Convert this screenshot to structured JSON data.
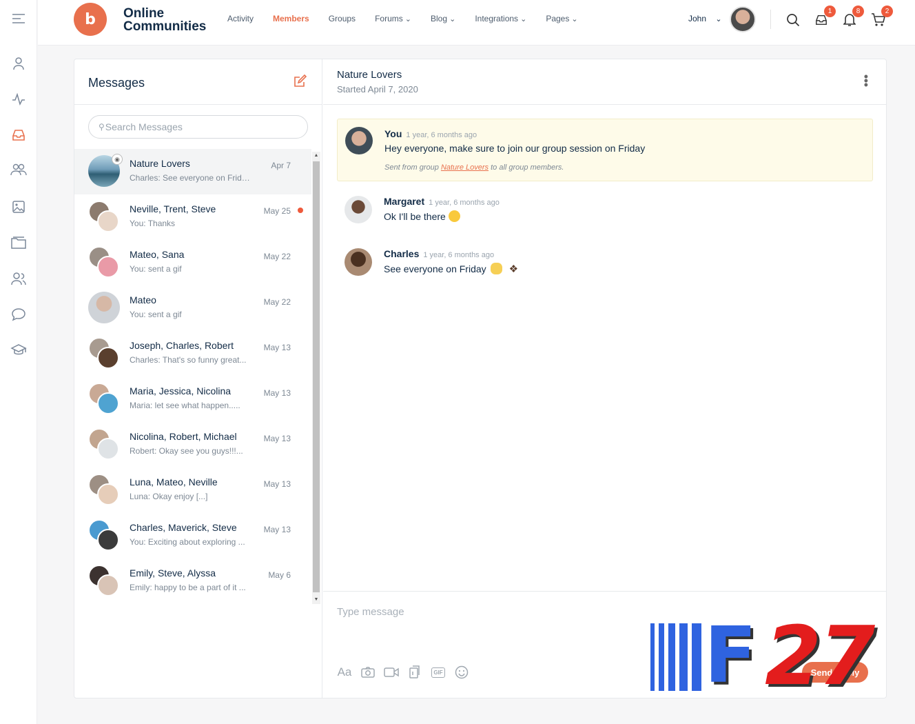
{
  "brand": {
    "name_line1": "Online",
    "name_line2": "Communities",
    "logo_text": "b"
  },
  "nav": [
    {
      "label": "Activity",
      "active": false,
      "dropdown": false
    },
    {
      "label": "Members",
      "active": true,
      "dropdown": false
    },
    {
      "label": "Groups",
      "active": false,
      "dropdown": false
    },
    {
      "label": "Forums",
      "active": false,
      "dropdown": true
    },
    {
      "label": "Blog",
      "active": false,
      "dropdown": true
    },
    {
      "label": "Integrations",
      "active": false,
      "dropdown": true
    },
    {
      "label": "Pages",
      "active": false,
      "dropdown": true
    }
  ],
  "header": {
    "user_name": "John",
    "badges": {
      "messages": "1",
      "notifications": "8",
      "cart": "2"
    }
  },
  "sidebar_icons": [
    "menu-icon",
    "profile-icon",
    "activity-icon",
    "inbox-icon",
    "groups-icon",
    "photos-icon",
    "folder-icon",
    "friends-icon",
    "forums-icon",
    "courses-icon"
  ],
  "messages": {
    "title": "Messages",
    "search_placeholder": "Search Messages",
    "threads": [
      {
        "names": "Nature Lovers",
        "preview": "Charles: See everyone on Friday",
        "date": "Apr 7",
        "active": true,
        "unread": false
      },
      {
        "names": "Neville, Trent, Steve",
        "preview": "You: Thanks",
        "date": "May 25",
        "active": false,
        "unread": true
      },
      {
        "names": "Mateo, Sana",
        "preview": "You: sent a gif",
        "date": "May 22",
        "active": false,
        "unread": false
      },
      {
        "names": "Mateo",
        "preview": "You: sent a gif",
        "date": "May 22",
        "active": false,
        "unread": false
      },
      {
        "names": "Joseph, Charles, Robert",
        "preview": "Charles: That's so funny great...",
        "date": "May 13",
        "active": false,
        "unread": false
      },
      {
        "names": "Maria, Jessica, Nicolina",
        "preview": "Maria: let see what happen.....",
        "date": "May 13",
        "active": false,
        "unread": false
      },
      {
        "names": "Nicolina, Robert, Michael",
        "preview": "Robert: Okay see you guys!!!...",
        "date": "May 13",
        "active": false,
        "unread": false
      },
      {
        "names": "Luna, Mateo, Neville",
        "preview": "Luna: Okay enjoy [...]",
        "date": "May 13",
        "active": false,
        "unread": false
      },
      {
        "names": "Charles, Maverick, Steve",
        "preview": "You: Exciting about exploring ...",
        "date": "May 13",
        "active": false,
        "unread": false
      },
      {
        "names": "Emily, Steve, Alyssa",
        "preview": "Emily: happy to be a part of it ...",
        "date": "May 6",
        "active": false,
        "unread": false
      }
    ]
  },
  "conversation": {
    "title": "Nature Lovers",
    "subtitle": "Started April 7, 2020",
    "messages": [
      {
        "author": "You",
        "time": "1 year, 6 months ago",
        "text": "Hey everyone, make sure to join our group session on Friday",
        "note_prefix": "Sent from group",
        "note_link": "Nature Lovers",
        "note_suffix": "to all group members."
      },
      {
        "author": "Margaret",
        "time": "1 year, 6 months ago",
        "text": "Ok I'll be there"
      },
      {
        "author": "Charles",
        "time": "1 year, 6 months ago",
        "text": "See everyone on Friday"
      }
    ],
    "composer_placeholder": "Type message",
    "toolbar": {
      "text_format": "Aa",
      "gif": "GIF"
    },
    "send_label": "Send Reply"
  },
  "watermark": {
    "text_f": "F",
    "text_num": "27"
  },
  "colors": {
    "accent": "#e8704d",
    "badge": "#ee5a3c",
    "highlight_bg": "#fefbe9"
  }
}
